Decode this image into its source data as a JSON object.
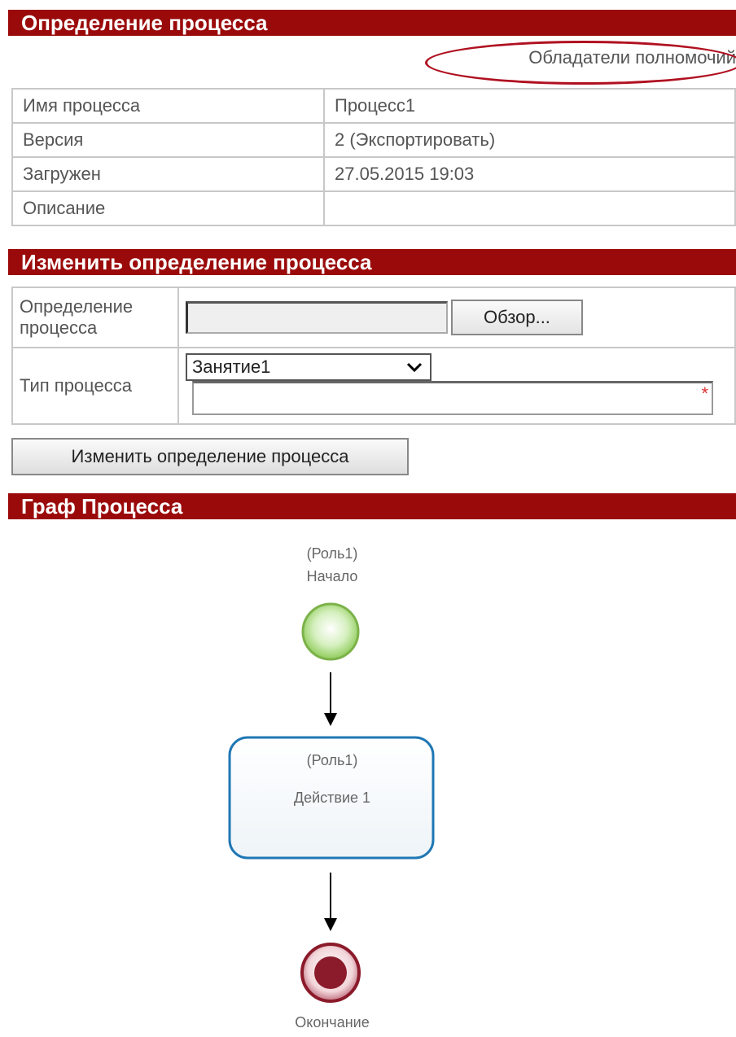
{
  "definition": {
    "title": "Определение процесса",
    "perms_link": "Обладатели полномочий",
    "rows": [
      {
        "label": "Имя процесса",
        "value": "Процесс1"
      },
      {
        "label": "Версия",
        "value": "2 (Экспортировать)"
      },
      {
        "label": "Загружен",
        "value": "27.05.2015 19:03"
      },
      {
        "label": "Описание",
        "value": ""
      }
    ]
  },
  "change": {
    "title": "Изменить определение процесса",
    "def_label": "Определение процесса",
    "browse_label": "Обзор...",
    "type_label": "Тип процесса",
    "type_selected": "Занятие1",
    "required_mark": "*",
    "submit_label": "Изменить определение процесса"
  },
  "graph": {
    "title": "Граф Процесса",
    "start_role": "(Роль1)",
    "start_label": "Начало",
    "task_role": "(Роль1)",
    "task_label": "Действие 1",
    "end_label": "Окончание",
    "colors": {
      "start": "#9bd46a",
      "task_border": "#1f77b4",
      "end": "#8b1a2a"
    }
  }
}
